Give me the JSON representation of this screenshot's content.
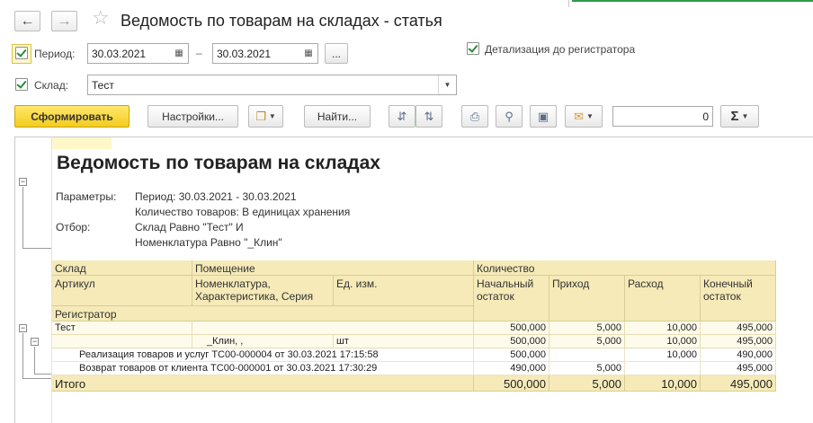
{
  "window": {
    "title": "Ведомость по товарам на складах - статья"
  },
  "form": {
    "period_label": "Период:",
    "period_from": "30.03.2021",
    "period_separator": "–",
    "period_to": "30.03.2021",
    "period_more": "...",
    "detail_label": "Детализация до регистратора",
    "warehouse_label": "Склад:",
    "warehouse_value": "Тест"
  },
  "toolbar": {
    "generate_label": "Сформировать",
    "settings_label": "Настройки...",
    "find_label": "Найти...",
    "sum_value": "0",
    "sum_symbol": "Σ"
  },
  "report": {
    "title": "Ведомость по товарам на складах",
    "params_label": "Параметры:",
    "params_lines": [
      "Период: 30.03.2021 - 30.03.2021",
      "Количество товаров: В единицах хранения"
    ],
    "filter_label": "Отбор:",
    "filter_lines": [
      "Склад Равно \"Тест\" И",
      "Номенклатура Равно \"_Клин\""
    ]
  },
  "table": {
    "headers": {
      "warehouse": "Склад",
      "room": "Помещение",
      "quantity": "Количество",
      "article": "Артикул",
      "nomenclature": "Номенклатура, Характеристика, Серия",
      "nomenclature_line1": "Номенклатура,",
      "nomenclature_line2": "Характеристика, Серия",
      "unit": "Ед. изм.",
      "opening": "Начальный остаток",
      "opening_line1": "Начальный",
      "opening_line2": "остаток",
      "income": "Приход",
      "expense": "Расход",
      "closing": "Конечный остаток",
      "closing_line1": "Конечный",
      "closing_line2": "остаток",
      "registrar": "Регистратор"
    },
    "rows": [
      {
        "name": "Тест",
        "unit": "",
        "opening": "500,000",
        "income": "5,000",
        "expense": "10,000",
        "closing": "495,000"
      },
      {
        "name": "_Клин, ,",
        "unit": "шт",
        "opening": "500,000",
        "income": "5,000",
        "expense": "10,000",
        "closing": "495,000"
      },
      {
        "name": "Реализация товаров и услуг ТС00-000004 от 30.03.2021 17:15:58",
        "unit": "",
        "opening": "500,000",
        "income": "",
        "expense": "10,000",
        "closing": "490,000"
      },
      {
        "name": "Возврат товаров от клиента ТС00-000001 от 30.03.2021 17:30:29",
        "unit": "",
        "opening": "490,000",
        "income": "5,000",
        "expense": "",
        "closing": "495,000"
      }
    ],
    "total": {
      "label": "Итого",
      "opening": "500,000",
      "income": "5,000",
      "expense": "10,000",
      "closing": "495,000"
    }
  },
  "icons": {
    "back": "arrow-left-icon",
    "forward": "arrow-right-icon",
    "favorite": "star-icon",
    "calendar": "calendar-icon",
    "dropdown": "chevron-down-icon",
    "copy": "copy-icon",
    "sort_asc": "sort-ascending-icon",
    "sort_desc": "sort-descending-icon",
    "print": "printer-icon",
    "preview": "print-preview-icon",
    "save": "floppy-disk-icon",
    "mail": "envelope-icon",
    "sum": "sigma-icon"
  },
  "colors": {
    "accent_yellow": "#f3cc1d",
    "header_fill": "#f5eab8",
    "row_fill": "#fffbea",
    "check_green": "#2e8b3a"
  }
}
